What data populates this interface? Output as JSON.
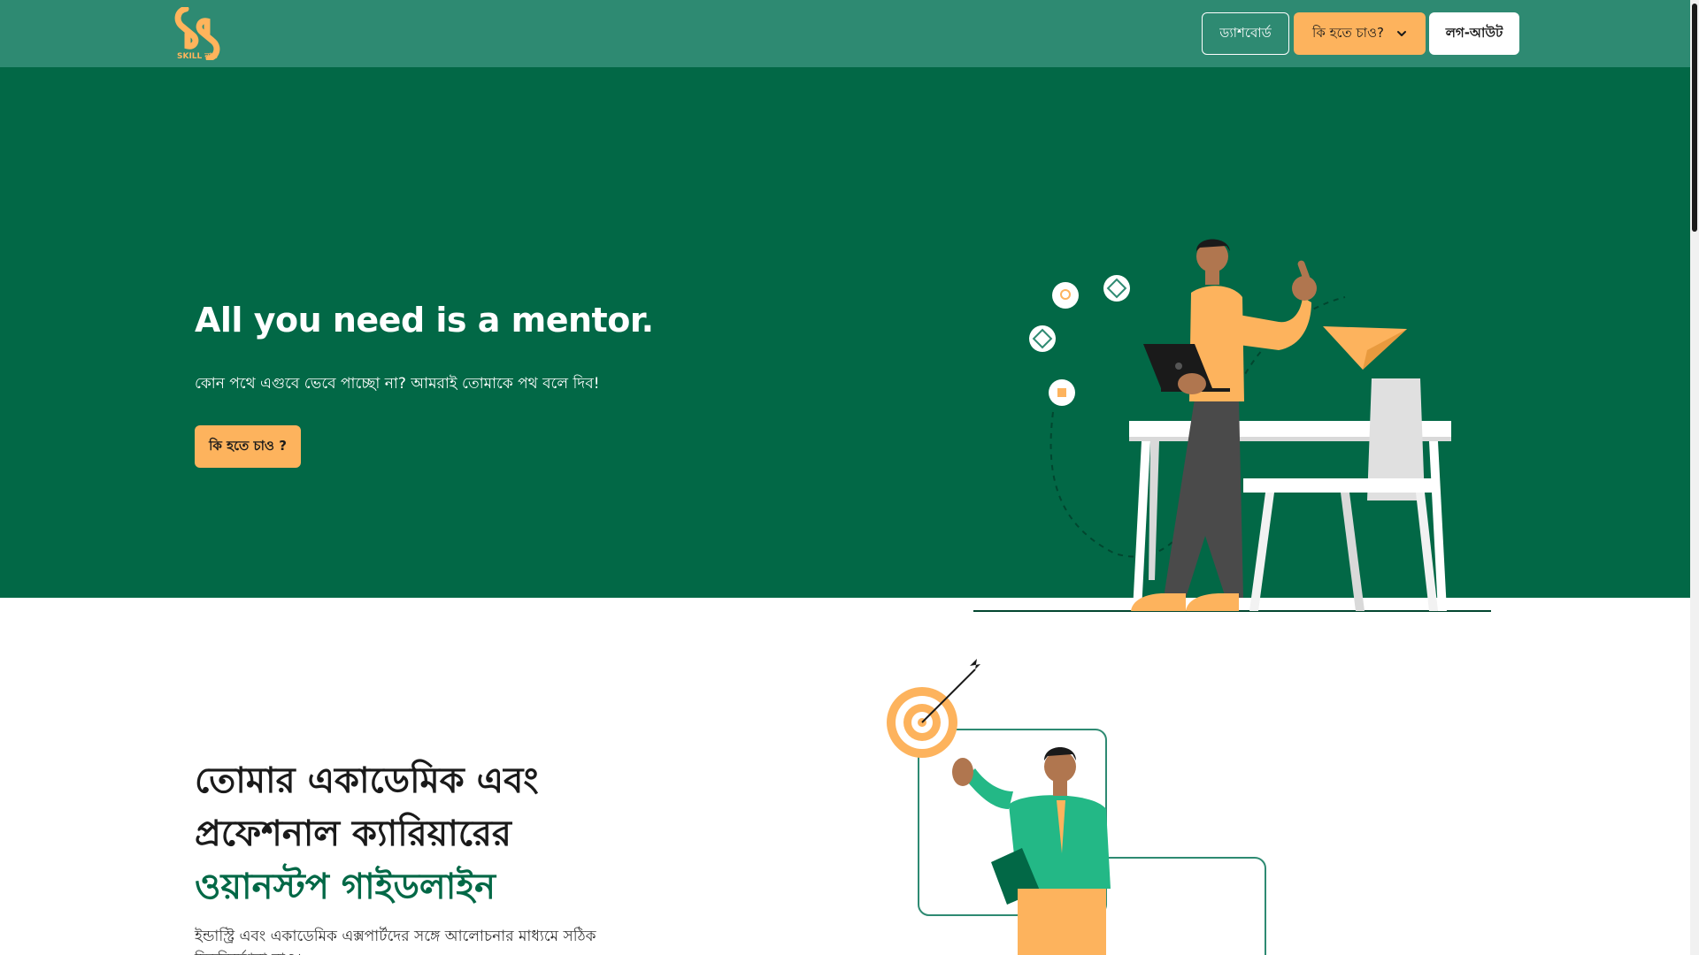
{
  "navbar": {
    "logo_text": "SKILL নাও",
    "dashboard_label": "ড্যাশবোর্ড",
    "what_to_be_label": "কি হতে চাও?",
    "logout_label": "লগ-আউট",
    "icons": {
      "dropdown": "chevron-down-icon"
    },
    "colors": {
      "bar": "#2e8a72",
      "accent": "#fdb35d"
    }
  },
  "hero": {
    "title": "All you need is a mentor.",
    "subtitle": "কোন পথে এগুবে ভেবে পাচ্ছো না? আমরাই তোমাকে পথ বলে দিব!",
    "cta_label": "কি হতে চাও ?",
    "colors": {
      "background": "#026846"
    }
  },
  "section2": {
    "title_line1": "তোমার একাডেমিক এবং",
    "title_line2": "প্রফেশনাল ক্যারিয়ারের",
    "title_line3": "ওয়ানস্টপ গাইডলাইন",
    "description": "ইন্ডাস্ট্রি এবং একাডেমিক এক্সপার্টদের সঙ্গে আলোচনার মাধ্যমে সঠিক দিকনির্দেশনা নাও।",
    "colors": {
      "accent_text": "#026846"
    }
  }
}
